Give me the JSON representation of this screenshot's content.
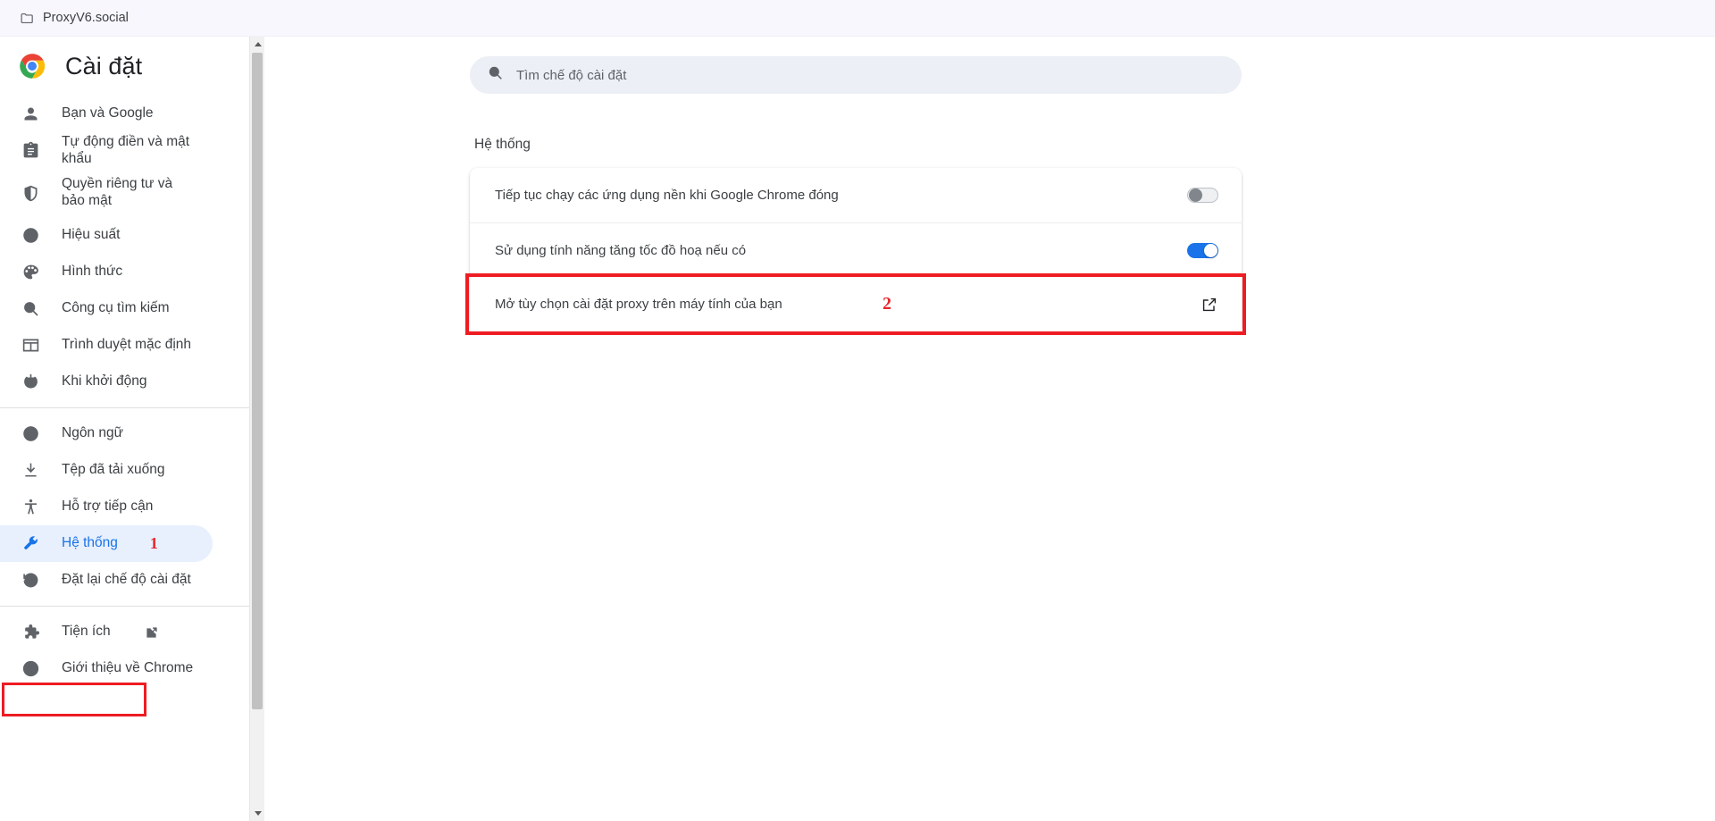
{
  "bookmarks_bar": {
    "items": [
      {
        "label": "ProxyV6.social",
        "icon": "folder-icon"
      }
    ]
  },
  "sidebar": {
    "brand": {
      "title": "Cài đặt",
      "logo": "chrome-logo"
    },
    "groups": [
      {
        "items": [
          {
            "label": "Bạn và Google",
            "icon": "person-icon",
            "selected": false
          },
          {
            "label": "Tự động điền và mật khẩu",
            "icon": "clipboard-icon",
            "selected": false
          },
          {
            "label": "Quyền riêng tư và bảo mật",
            "icon": "shield-icon",
            "selected": false,
            "two_line": true
          },
          {
            "label": "Hiệu suất",
            "icon": "speedometer-icon",
            "selected": false
          },
          {
            "label": "Hình thức",
            "icon": "palette-icon",
            "selected": false
          },
          {
            "label": "Công cụ tìm kiếm",
            "icon": "search-icon",
            "selected": false
          },
          {
            "label": "Trình duyệt mặc định",
            "icon": "browser-icon",
            "selected": false
          },
          {
            "label": "Khi khởi động",
            "icon": "power-icon",
            "selected": false
          }
        ]
      },
      {
        "items": [
          {
            "label": "Ngôn ngữ",
            "icon": "globe-icon",
            "selected": false
          },
          {
            "label": "Tệp đã tải xuống",
            "icon": "download-icon",
            "selected": false
          },
          {
            "label": "Hỗ trợ tiếp cận",
            "icon": "accessibility-icon",
            "selected": false
          },
          {
            "label": "Hệ thống",
            "icon": "wrench-icon",
            "selected": true,
            "marker": "1"
          },
          {
            "label": "Đặt lại chế độ cài đặt",
            "icon": "restore-icon",
            "selected": false
          }
        ]
      },
      {
        "items": [
          {
            "label": "Tiện ích",
            "icon": "puzzle-icon",
            "selected": false,
            "external": true
          },
          {
            "label": "Giới thiệu về Chrome",
            "icon": "chrome-outline-icon",
            "selected": false
          }
        ]
      }
    ]
  },
  "search": {
    "placeholder": "Tìm chế độ cài đặt",
    "value": "",
    "icon": "search-icon"
  },
  "main": {
    "section_title": "Hệ thống",
    "rows": [
      {
        "label": "Tiếp tục chạy các ứng dụng nền khi Google Chrome đóng",
        "control": "toggle",
        "toggle_state": "off",
        "highlighted": false,
        "marker": ""
      },
      {
        "label": "Sử dụng tính năng tăng tốc đồ hoạ nếu có",
        "control": "toggle",
        "toggle_state": "on",
        "highlighted": false,
        "marker": ""
      },
      {
        "label": "Mở tùy chọn cài đặt proxy trên máy tính của bạn",
        "control": "external-link",
        "toggle_state": "",
        "highlighted": true,
        "marker": "2"
      }
    ]
  },
  "colors": {
    "accent": "#1a73e8",
    "annotation_red": "#ee1c23",
    "selected_bg": "#e8f0fe",
    "search_bg": "#eceff5",
    "bookmarks_bg": "#f8f7fd",
    "text": "#3c4043"
  }
}
